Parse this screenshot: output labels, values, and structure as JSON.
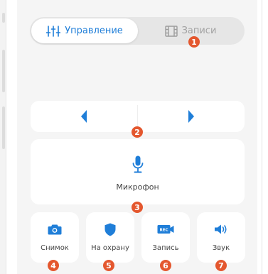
{
  "colors": {
    "accent": "#1f7ed8",
    "marker": "#e4572e",
    "inactive": "#a2a2a2",
    "background": "#f5f5f5"
  },
  "tabs": [
    {
      "label": "Управление",
      "icon": "sliders-icon",
      "active": true
    },
    {
      "label": "Записи",
      "icon": "film-icon",
      "active": false
    }
  ],
  "navigation": {
    "left_icon": "arrow-left-icon",
    "right_icon": "arrow-right-icon"
  },
  "microphone": {
    "label": "Микрофон",
    "icon": "microphone-icon"
  },
  "actions": [
    {
      "label": "Снимок",
      "icon": "camera-icon"
    },
    {
      "label": "На охрану",
      "icon": "shield-icon"
    },
    {
      "label": "Запись",
      "icon": "rec-icon",
      "icon_text": "REC"
    },
    {
      "label": "Звук",
      "icon": "speaker-icon"
    }
  ],
  "markers": [
    "1",
    "2",
    "3",
    "4",
    "5",
    "6",
    "7"
  ]
}
